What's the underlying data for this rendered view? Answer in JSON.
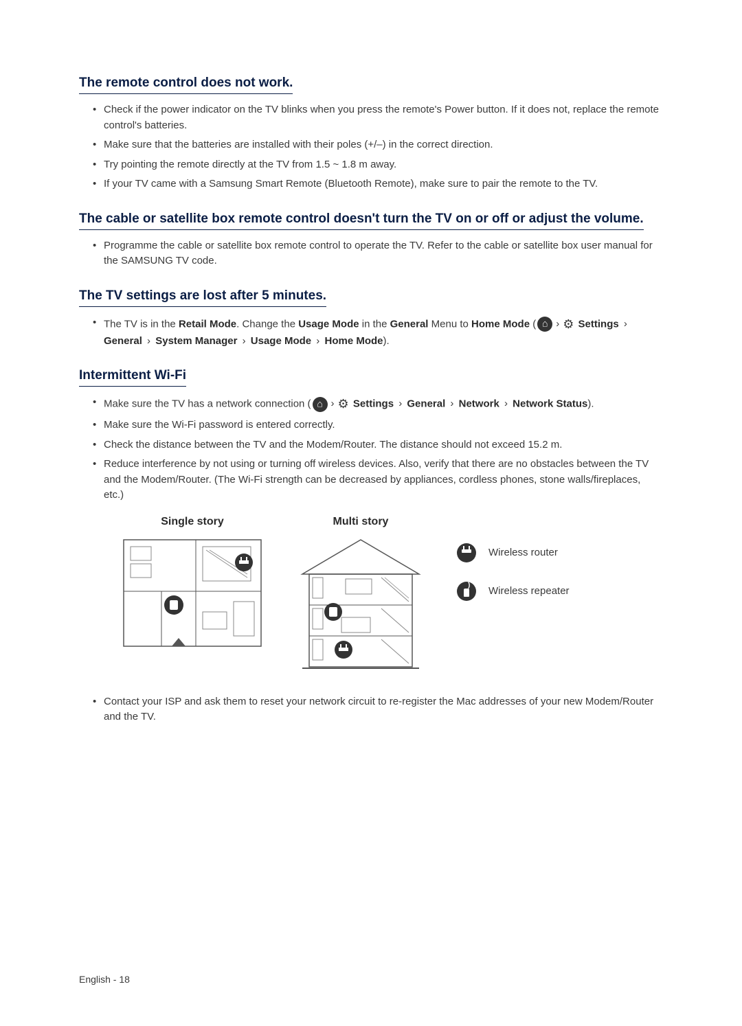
{
  "sections": {
    "remote": {
      "heading": "The remote control does not work.",
      "bullets": [
        "Check if the power indicator on the TV blinks when you press the remote's Power button. If it does not, replace the remote control's batteries.",
        "Make sure that the batteries are installed with their poles (+/–) in the correct direction.",
        "Try pointing the remote directly at the TV from 1.5 ~ 1.8 m away.",
        "If your TV came with a Samsung Smart Remote (Bluetooth Remote), make sure to pair the remote to the TV."
      ]
    },
    "cable": {
      "heading": "The cable or satellite box remote control doesn't turn the TV on or off or adjust the volume.",
      "bullets": [
        "Programme the cable or satellite box remote control to operate the TV. Refer to the cable or satellite box user manual for the SAMSUNG TV code."
      ]
    },
    "settings": {
      "heading": "The TV settings are lost after 5 minutes.",
      "bullet_prefix": "The TV is in the ",
      "retail_mode": "Retail Mode",
      "change_text": ". Change the ",
      "usage_mode": "Usage Mode",
      "in_the": " in the ",
      "general": "General",
      "menu_to": " Menu to ",
      "home_mode": "Home Mode",
      "open_paren": " (",
      "settings_label": "Settings",
      "path": [
        "General",
        "System Manager",
        "Usage Mode",
        "Home Mode"
      ],
      "close": ")."
    },
    "wifi": {
      "heading": "Intermittent Wi-Fi",
      "bullet1_prefix": "Make sure the TV has a network connection (",
      "bullet1_settings": "Settings",
      "bullet1_path": [
        "General",
        "Network",
        "Network Status"
      ],
      "bullet1_close": ").",
      "bullets_rest": [
        "Make sure the Wi-Fi password is entered correctly.",
        "Check the distance between the TV and the Modem/Router. The distance should not exceed 15.2 m.",
        "Reduce interference by not using or turning off wireless devices. Also, verify that there are no obstacles between the TV and the Modem/Router. (The Wi-Fi strength can be decreased by appliances, cordless phones, stone walls/fireplaces, etc.)"
      ],
      "diagram_single": "Single story",
      "diagram_multi": "Multi story",
      "legend_router": "Wireless router",
      "legend_repeater": "Wireless repeater",
      "bullet_last": "Contact your ISP and ask them to reset your network circuit to re-register the Mac addresses of your new Modem/Router and the TV."
    }
  },
  "footer": {
    "language": "English",
    "page": "18"
  }
}
